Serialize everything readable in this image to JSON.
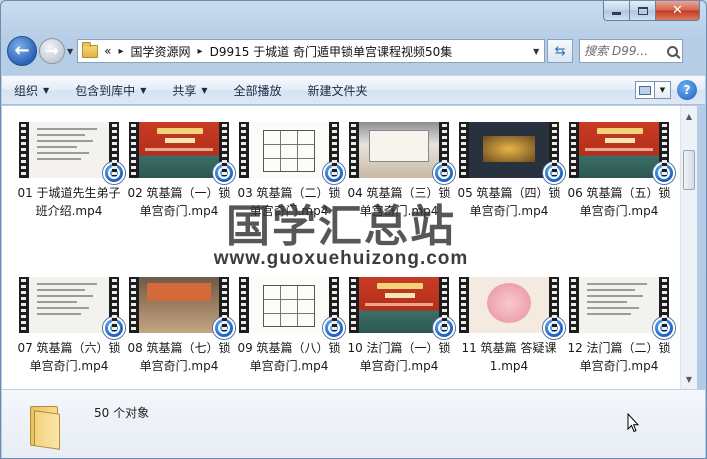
{
  "window": {
    "caption_buttons": {
      "minimize": "minimize-icon",
      "maximize": "maximize-icon",
      "close": "✕"
    }
  },
  "nav": {
    "back_icon": "back-arrow-icon",
    "forward_icon": "forward-arrow-icon",
    "breadcrumb": [
      "国学资源网",
      "D9915 于城道 奇门遁甲锁单宫课程视频50集"
    ],
    "breadcrumb_prefix": "«",
    "separator": "▸",
    "search_placeholder": "搜索 D99..."
  },
  "toolbar": {
    "organize": "组织",
    "include_in_library": "包含到库中",
    "share": "共享",
    "play_all": "全部播放",
    "new_folder": "新建文件夹",
    "help": "?"
  },
  "files": [
    {
      "name": "01 于城道先生弟子班介绍.mp4",
      "thumb": "doc"
    },
    {
      "name": "02 筑基篇（一）锁单宫奇门.mp4",
      "thumb": "red"
    },
    {
      "name": "03 筑基篇（二）锁单宫奇门.mp4",
      "thumb": "grid9"
    },
    {
      "name": "04 筑基篇（三）锁单宫奇门.mp4",
      "thumb": "room"
    },
    {
      "name": "05 筑基篇（四）锁单宫奇门.mp4",
      "thumb": "dark"
    },
    {
      "name": "06 筑基篇（五）锁单宫奇门.mp4",
      "thumb": "red"
    },
    {
      "name": "07 筑基篇（六）锁单宫奇门.mp4",
      "thumb": "doc"
    },
    {
      "name": "08 筑基篇（七）锁单宫奇门.mp4",
      "thumb": "crowd"
    },
    {
      "name": "09 筑基篇（八）锁单宫奇门.mp4",
      "thumb": "grid9"
    },
    {
      "name": "10 法门篇（一）锁单宫奇门.mp4",
      "thumb": "red"
    },
    {
      "name": "11 筑基篇 答疑课1.mp4",
      "thumb": "pink"
    },
    {
      "name": "12 法门篇（二）锁单宫奇门.mp4",
      "thumb": "doc"
    }
  ],
  "watermark": {
    "text": "国学汇总站",
    "url": "www.guoxuehuizong.com"
  },
  "status": {
    "count": "50 个对象"
  }
}
